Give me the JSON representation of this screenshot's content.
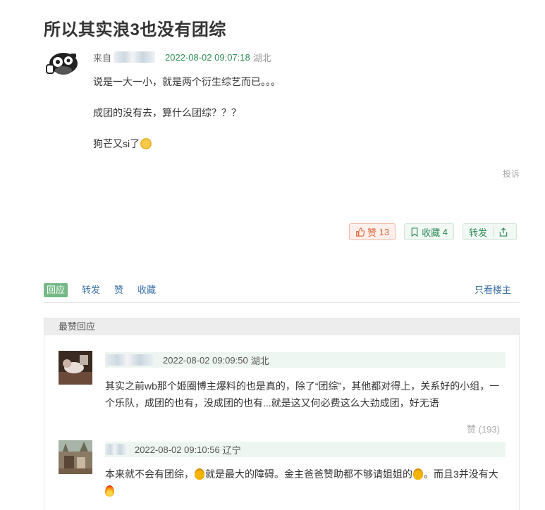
{
  "post": {
    "title": "所以其实浪3也没有团综",
    "from_label": "来自",
    "time": "2022-08-02 09:07:18",
    "location": "湖北",
    "paragraphs": [
      "说是一大一小，就是两个衍生综艺而已。。。",
      "成团的没有去，算什么团综？？？",
      "狗芒又si了"
    ],
    "report_label": "投诉"
  },
  "actions": {
    "like_label": "赞",
    "like_count": "13",
    "fav_label": "收藏",
    "fav_count": "4",
    "share_label": "转发"
  },
  "tabs": {
    "reply": "回应",
    "forward": "转发",
    "like": "赞",
    "collect": "收藏",
    "author_only": "只看楼主"
  },
  "best": {
    "header": "最赞回应",
    "comments": [
      {
        "time": "2022-08-02 09:09:50",
        "location": "湖北",
        "text_line1": "其实之前wb那个姬圈博主爆料的也是真的，除了“团综”，其他都对得上，关系好的小组，一",
        "text_line2": "个乐队，成团的也有，没成团的也有...就是这又何必费这么大劲成团，好无语",
        "like_label": "赞 (193)"
      },
      {
        "time": "2022-08-02 09:10:56",
        "location": "辽宁",
        "text_a": "本来就不会有团综，",
        "text_b": "就是最大的障碍。金主爸爸赞助都不够请姐姐的",
        "text_c": "。而且3并没有大"
      }
    ]
  },
  "colors": {
    "accent_green": "#2e8b57",
    "tab_active_bg": "#74b985",
    "like_orange": "#e0663c",
    "link_blue": "#3a6ea5"
  }
}
